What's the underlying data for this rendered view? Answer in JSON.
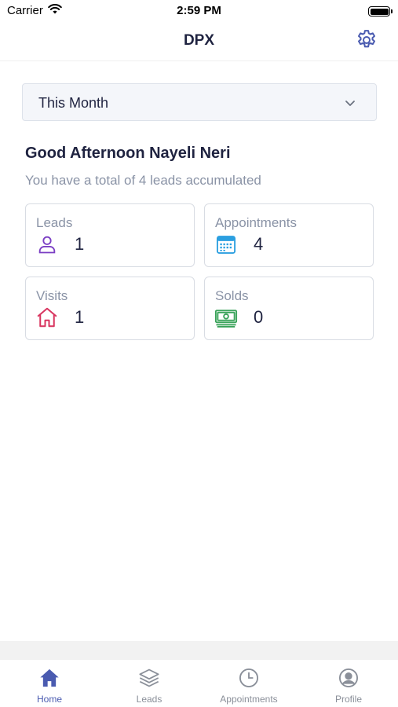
{
  "status_bar": {
    "carrier": "Carrier",
    "time": "2:59 PM"
  },
  "nav": {
    "title": "DPX",
    "settings_icon": "gear-icon"
  },
  "filter": {
    "selected": "This Month"
  },
  "greeting": {
    "title": "Good Afternoon Nayeli Neri",
    "subtitle": "You have a total of 4 leads accumulated"
  },
  "stats": [
    {
      "label": "Leads",
      "value": "1",
      "icon": "user-icon",
      "color": "#7b3fc4"
    },
    {
      "label": "Appointments",
      "value": "4",
      "icon": "calendar-icon",
      "color": "#2b9fe0"
    },
    {
      "label": "Visits",
      "value": "1",
      "icon": "home-icon",
      "color": "#d8345f"
    },
    {
      "label": "Solds",
      "value": "0",
      "icon": "money-icon",
      "color": "#3aa35a"
    }
  ],
  "tabs": [
    {
      "label": "Home",
      "icon": "home-icon",
      "active": true
    },
    {
      "label": "Leads",
      "icon": "layers-icon",
      "active": false
    },
    {
      "label": "Appointments",
      "icon": "clock-icon",
      "active": false
    },
    {
      "label": "Profile",
      "icon": "profile-icon",
      "active": false
    }
  ],
  "colors": {
    "accent": "#4a5bb0",
    "text_dark": "#1f2340",
    "text_muted": "#8a93a6"
  }
}
